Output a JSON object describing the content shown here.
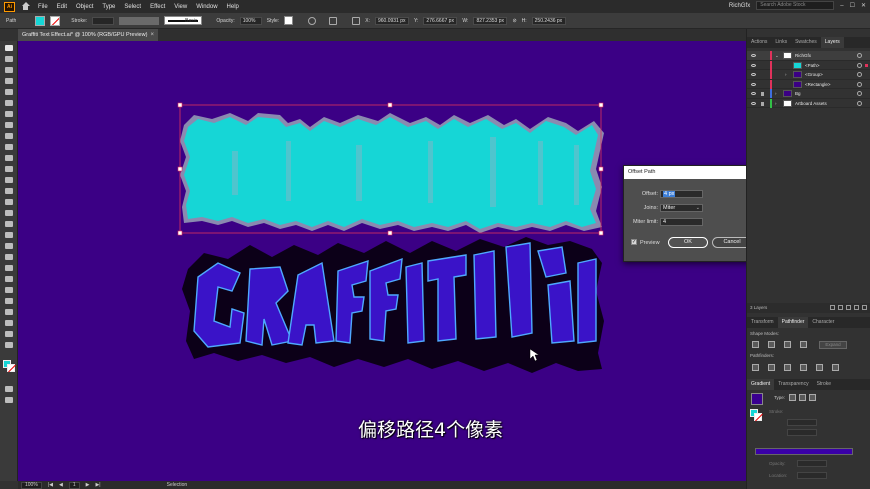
{
  "app": {
    "logo": "Ai"
  },
  "menubar": {
    "items": [
      "File",
      "Edit",
      "Object",
      "Type",
      "Select",
      "Effect",
      "View",
      "Window",
      "Help"
    ],
    "workspace": "RichGfx",
    "search_placeholder": "Search Adobe Stock"
  },
  "controlbar": {
    "object_type": "Path",
    "stroke_label": "Stroke:",
    "brush_label": "Basic",
    "opacity_label": "Opacity:",
    "opacity_value": "100%",
    "style_label": "Style:",
    "x_label": "X:",
    "x_value": "960.0931 px",
    "y_label": "Y:",
    "y_value": "276.6667 px",
    "w_label": "W:",
    "w_value": "827.2353 px",
    "h_label": "H:",
    "h_value": "250.2436 px"
  },
  "document": {
    "tab_title": "Graffiti Text Effect.ai* @ 100% (RGB/GPU Preview)",
    "close": "×",
    "subtitle": "偏移路径4个像素"
  },
  "statusbar": {
    "zoom": "100%",
    "artboard": "1",
    "tool": "Selection"
  },
  "dialog": {
    "title": "Offset Path",
    "offset_label": "Offset:",
    "offset_value": "4 px",
    "joins_label": "Joins:",
    "joins_value": "Miter",
    "miter_label": "Miter limit:",
    "miter_value": "4",
    "preview_label": "Preview",
    "preview_checked": true,
    "ok_label": "OK",
    "cancel_label": "Cancel"
  },
  "layers_panel": {
    "tabs": [
      "Actions",
      "Links",
      "Swatches",
      "Layers"
    ],
    "active_tab": "Layers",
    "rows": [
      {
        "name": "RichGfx",
        "indent": 0,
        "color": "#e0325b",
        "expanded": true,
        "selected": true
      },
      {
        "name": "<Path>",
        "indent": 2,
        "color": "#e0325b",
        "expanded": false,
        "selected": true
      },
      {
        "name": "<Group>",
        "indent": 2,
        "color": "#e0325b",
        "expanded": false,
        "selected": false
      },
      {
        "name": "<Rectangle>",
        "indent": 2,
        "color": "#e0325b",
        "expanded": false,
        "selected": false
      },
      {
        "name": "Bg",
        "indent": 0,
        "color": "#3f6fe0",
        "expanded": false,
        "selected": false
      },
      {
        "name": "Artboard Assets",
        "indent": 0,
        "color": "#32c047",
        "expanded": false,
        "selected": false
      }
    ],
    "footer": "3 Layers"
  },
  "pathfinder_panel": {
    "tabs": [
      "Transform",
      "Pathfinder",
      "Character"
    ],
    "active_tab": "Pathfinder",
    "shape_modes_label": "Shape Modes:",
    "expand_label": "Expand",
    "pathfinders_label": "Pathfinders:"
  },
  "gradient_panel": {
    "tabs": [
      "Gradient",
      "Transparency",
      "Stroke"
    ],
    "active_tab": "Gradient",
    "type_label": "Type:",
    "stroke_label": "Stroke:",
    "opacity_label": "Opacity:",
    "location_label": "Location:"
  },
  "colors": {
    "canvas": "#3b0085",
    "fill": "#16d6d6",
    "selection": "#e0325b"
  }
}
